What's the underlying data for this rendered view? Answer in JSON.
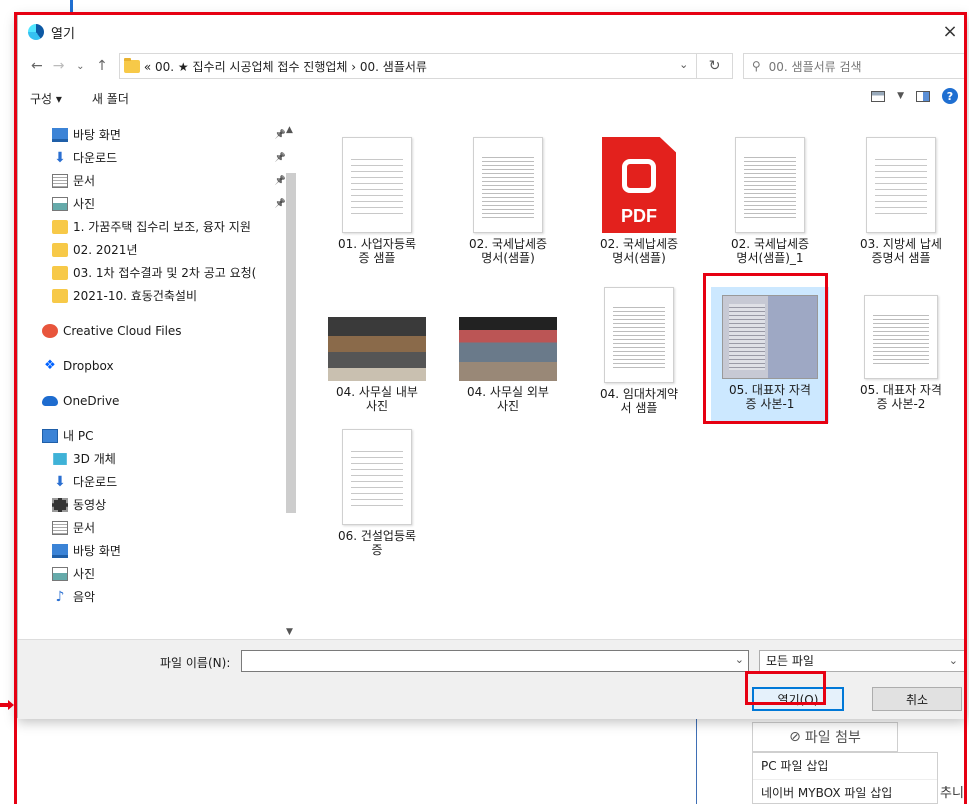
{
  "dialog": {
    "title": "열기",
    "close_icon": "×"
  },
  "address": {
    "path": "« 00. ★ 집수리 시공업체 접수 진행업체 › 00. 샘플서류",
    "search_placeholder": "00. 샘플서류 검색"
  },
  "toolbar": {
    "organize": "구성 ▾",
    "new_folder": "새 폴더",
    "help": "?"
  },
  "nav": {
    "items": [
      {
        "label": "바탕 화면",
        "icon": "desktop",
        "pinned": true
      },
      {
        "label": "다운로드",
        "icon": "download",
        "pinned": true
      },
      {
        "label": "문서",
        "icon": "document",
        "pinned": true
      },
      {
        "label": "사진",
        "icon": "picture",
        "pinned": true
      },
      {
        "label": "1. 가꿈주택 집수리 보조, 융자 지원",
        "icon": "folder"
      },
      {
        "label": "02. 2021년",
        "icon": "folder"
      },
      {
        "label": "03. 1차 접수결과 및 2차 공고 요청(",
        "icon": "folder"
      },
      {
        "label": "2021-10. 효동건축설비",
        "icon": "folder"
      },
      {
        "label": "Creative Cloud Files",
        "icon": "creative-cloud"
      },
      {
        "label": "Dropbox",
        "icon": "dropbox"
      },
      {
        "label": "OneDrive",
        "icon": "onedrive"
      },
      {
        "label": "내 PC",
        "icon": "pc"
      },
      {
        "label": "3D 개체",
        "icon": "cube"
      },
      {
        "label": "다운로드",
        "icon": "download"
      },
      {
        "label": "동영상",
        "icon": "video"
      },
      {
        "label": "문서",
        "icon": "document"
      },
      {
        "label": "바탕 화면",
        "icon": "desktop"
      },
      {
        "label": "사진",
        "icon": "picture"
      },
      {
        "label": "음악",
        "icon": "music"
      }
    ]
  },
  "files": [
    {
      "name_l1": "01. 사업자등록",
      "name_l2": "증 샘플",
      "kind": "doc"
    },
    {
      "name_l1": "02. 국세납세증",
      "name_l2": "명서(샘플)",
      "kind": "doc"
    },
    {
      "name_l1": "02. 국세납세증",
      "name_l2": "명서(샘플)",
      "kind": "pdf",
      "pdf_label": "PDF"
    },
    {
      "name_l1": "02. 국세납세증",
      "name_l2": "명서(샘플)_1",
      "kind": "doc"
    },
    {
      "name_l1": "03. 지방세 납세",
      "name_l2": "증명서 샘플",
      "kind": "doc"
    },
    {
      "name_l1": "04. 사무실 내부",
      "name_l2": "사진",
      "kind": "photo"
    },
    {
      "name_l1": "04. 사무실 외부",
      "name_l2": "사진",
      "kind": "photo"
    },
    {
      "name_l1": "04. 임대차계약",
      "name_l2": "서 샘플",
      "kind": "doc"
    },
    {
      "name_l1": "05. 대표자 자격",
      "name_l2": "증 사본-1",
      "kind": "cert",
      "selected": true
    },
    {
      "name_l1": "05. 대표자 자격",
      "name_l2": "증 사본-2",
      "kind": "doc"
    },
    {
      "name_l1": "06. 건설업등록",
      "name_l2": "증",
      "kind": "doc"
    }
  ],
  "bottom": {
    "filename_label": "파일 이름(N):",
    "filename_value": "",
    "filetype": "모든 파일",
    "open_button": "열기(O)",
    "cancel_button": "취소"
  },
  "background": {
    "attach_button": "파일 첨부",
    "menu_items": [
      "PC 파일 삽입",
      "네이버 MYBOX 파일 삽입"
    ],
    "side_text": "추니"
  },
  "colors": {
    "annotation_red": "#e60012",
    "accent_blue": "#0078d7",
    "selection": "#cce8ff"
  }
}
